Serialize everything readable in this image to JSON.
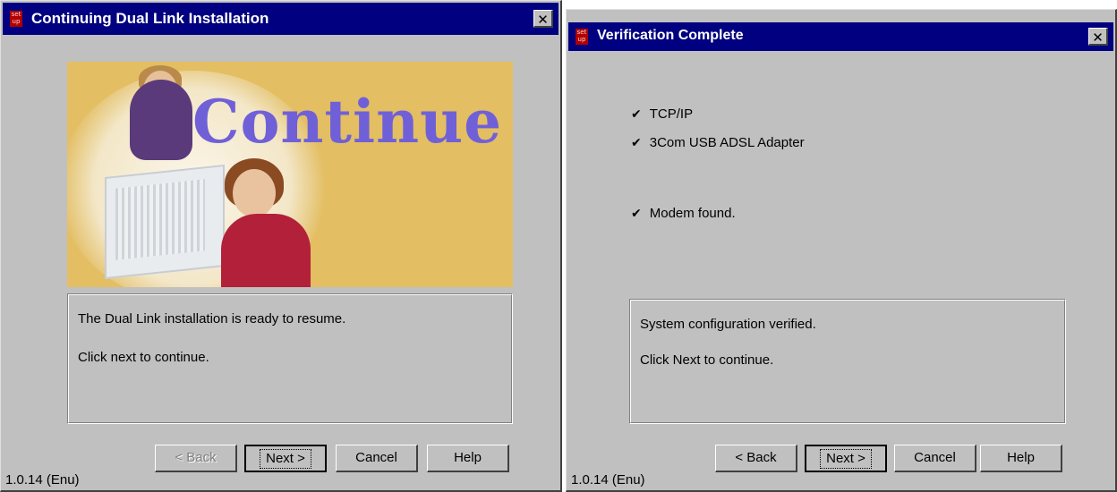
{
  "dialog1": {
    "title": "Continuing Dual Link Installation",
    "title_icon_text": "set up",
    "close_glyph": "✕",
    "banner_word": "Continue",
    "message_line1": "The Dual Link installation is ready to resume.",
    "message_line2": "Click next to continue.",
    "buttons": {
      "back": "< Back",
      "next": "Next >",
      "cancel": "Cancel",
      "help": "Help"
    },
    "version": "1.0.14 (Enu)"
  },
  "dialog2": {
    "title": "Verification Complete",
    "title_icon_text": "set up",
    "close_glyph": "✕",
    "checks": [
      {
        "mark": "✔",
        "label": "TCP/IP"
      },
      {
        "mark": "✔",
        "label": "3Com USB ADSL Adapter"
      },
      {
        "mark": "✔",
        "label": "Modem found."
      }
    ],
    "message_line1": "System configuration verified.",
    "message_line2": "Click Next to continue.",
    "buttons": {
      "back": "< Back",
      "next": "Next >",
      "cancel": "Cancel",
      "help": "Help"
    },
    "version": "1.0.14 (Enu)"
  },
  "colors": {
    "titlebar": "#000080",
    "face": "#c0c0c0",
    "banner": "#e3be63",
    "banner_word": "#7060d8"
  }
}
